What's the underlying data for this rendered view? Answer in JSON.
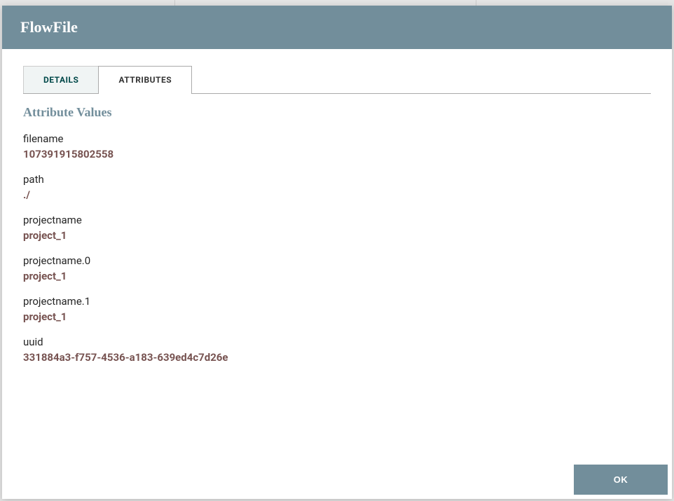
{
  "modal": {
    "title": "FlowFile"
  },
  "tabs": {
    "details": "DETAILS",
    "attributes": "ATTRIBUTES"
  },
  "section": {
    "title": "Attribute Values"
  },
  "attributes": [
    {
      "name": "filename",
      "value": "107391915802558"
    },
    {
      "name": "path",
      "value": "./"
    },
    {
      "name": "projectname",
      "value": "project_1"
    },
    {
      "name": "projectname.0",
      "value": "project_1"
    },
    {
      "name": "projectname.1",
      "value": "project_1"
    },
    {
      "name": "uuid",
      "value": "331884a3-f757-4536-a183-639ed4c7d26e"
    }
  ],
  "buttons": {
    "ok": "OK"
  }
}
